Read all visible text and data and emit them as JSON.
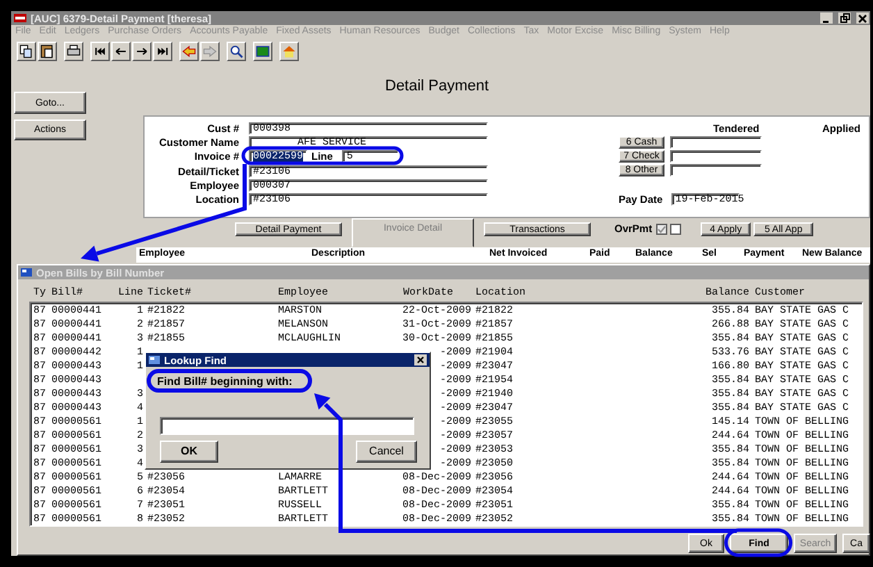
{
  "window": {
    "title": "[AUC] 6379-Detail Payment [theresa]"
  },
  "menu": [
    "File",
    "Edit",
    "Ledgers",
    "Purchase Orders",
    "Accounts Payable",
    "Fixed Assets",
    "Human Resources",
    "Budget",
    "Collections",
    "Tax",
    "Motor Excise",
    "Misc Billing",
    "System",
    "Help"
  ],
  "left_buttons": [
    "Goto...",
    "Actions"
  ],
  "heading": "Detail Payment",
  "form": {
    "fields": [
      {
        "kind": "text",
        "label": "Cust #",
        "value": "000398"
      },
      {
        "kind": "text",
        "label": "Customer Name",
        "value": "AFE SERVICE"
      },
      {
        "kind": "invoice",
        "label": "Invoice #",
        "value": "00022599",
        "selected": true,
        "line_label": "Line",
        "line_value": "5"
      },
      {
        "kind": "text",
        "label": "Detail/Ticket",
        "value": "#23106"
      },
      {
        "kind": "text",
        "label": "Employee",
        "value": "000307"
      },
      {
        "kind": "text",
        "label": "Location",
        "value": "#23106"
      }
    ]
  },
  "payment": {
    "tendered_label": "Tendered",
    "applied_label": "Applied",
    "methods": [
      "6 Cash",
      "7 Check",
      "8 Other"
    ],
    "pay_date_label": "Pay Date",
    "pay_date": "19-Feb-2015"
  },
  "tabs": [
    {
      "label": "Detail Payment",
      "selected": false,
      "disabled": false
    },
    {
      "label": "Invoice Detail",
      "selected": true,
      "disabled": true
    },
    {
      "label": "Transactions",
      "selected": false,
      "disabled": false
    }
  ],
  "overpayment": {
    "label": "OvrPmt",
    "checks": [
      {
        "checked": true,
        "disabled": true
      },
      {
        "checked": false,
        "disabled": false
      }
    ]
  },
  "apply_buttons": [
    "4 Apply",
    "5 All App"
  ],
  "detail_columns": [
    "Employee",
    "Description",
    "Net Invoiced",
    "Paid",
    "Balance",
    "Sel",
    "Payment",
    "New Balance"
  ],
  "bills_window": {
    "title": "Open Bills by Bill Number",
    "columns": [
      "Ty",
      "Bill#",
      "Line",
      "Ticket#",
      "Employee",
      "WorkDate",
      "Location",
      "Balance",
      "Customer"
    ],
    "rows": [
      {
        "ty": "87",
        "bill": "00000441",
        "line": "1",
        "ticket": "#21822",
        "employee": "MARSTON",
        "workdate": "22-Oct-2009",
        "location": "#21822",
        "balance": "355.84",
        "customer": "BAY STATE GAS C"
      },
      {
        "ty": "87",
        "bill": "00000441",
        "line": "2",
        "ticket": "#21857",
        "employee": "MELANSON",
        "workdate": "31-Oct-2009",
        "location": "#21857",
        "balance": "266.88",
        "customer": "BAY STATE GAS C"
      },
      {
        "ty": "87",
        "bill": "00000441",
        "line": "3",
        "ticket": "#21855",
        "employee": "MCLAUGHLIN",
        "workdate": "30-Oct-2009",
        "location": "#21855",
        "balance": "355.84",
        "customer": "BAY STATE GAS C"
      },
      {
        "ty": "87",
        "bill": "00000442",
        "line": "1",
        "workdate": "-2009",
        "location": "#21904",
        "balance": "533.76",
        "customer": "BAY STATE GAS C"
      },
      {
        "ty": "87",
        "bill": "00000443",
        "line": "1",
        "workdate": "-2009",
        "location": "#23047",
        "balance": "166.80",
        "customer": "BAY STATE GAS C"
      },
      {
        "ty": "87",
        "bill": "00000443",
        "workdate": "-2009",
        "location": "#21954",
        "balance": "355.84",
        "customer": "BAY STATE GAS C"
      },
      {
        "ty": "87",
        "bill": "00000443",
        "line": "3",
        "workdate": "-2009",
        "location": "#21940",
        "balance": "355.84",
        "customer": "BAY STATE GAS C"
      },
      {
        "ty": "87",
        "bill": "00000443",
        "line": "4",
        "workdate": "-2009",
        "location": "#23047",
        "balance": "355.84",
        "customer": "BAY STATE GAS C"
      },
      {
        "ty": "87",
        "bill": "00000561",
        "line": "1",
        "workdate": "-2009",
        "location": "#23055",
        "balance": "145.14",
        "customer": "TOWN OF BELLING"
      },
      {
        "ty": "87",
        "bill": "00000561",
        "line": "2",
        "workdate": "-2009",
        "location": "#23057",
        "balance": "244.64",
        "customer": "TOWN OF BELLING"
      },
      {
        "ty": "87",
        "bill": "00000561",
        "line": "3",
        "workdate": "-2009",
        "location": "#23053",
        "balance": "355.84",
        "customer": "TOWN OF BELLING"
      },
      {
        "ty": "87",
        "bill": "00000561",
        "line": "4",
        "workdate": "-2009",
        "location": "#23050",
        "balance": "355.84",
        "customer": "TOWN OF BELLING"
      },
      {
        "ty": "87",
        "bill": "00000561",
        "line": "5",
        "ticket": "#23056",
        "employee": "LAMARRE",
        "workdate": "08-Dec-2009",
        "location": "#23056",
        "balance": "244.64",
        "customer": "TOWN OF BELLING"
      },
      {
        "ty": "87",
        "bill": "00000561",
        "line": "6",
        "ticket": "#23054",
        "employee": "BARTLETT",
        "workdate": "08-Dec-2009",
        "location": "#23054",
        "balance": "244.64",
        "customer": "TOWN OF BELLING"
      },
      {
        "ty": "87",
        "bill": "00000561",
        "line": "7",
        "ticket": "#23051",
        "employee": "RUSSELL",
        "workdate": "08-Dec-2009",
        "location": "#23051",
        "balance": "355.84",
        "customer": "TOWN OF BELLING"
      },
      {
        "ty": "87",
        "bill": "00000561",
        "line": "8",
        "ticket": "#23052",
        "employee": "BARTLETT",
        "workdate": "08-Dec-2009",
        "location": "#23052",
        "balance": "355.84",
        "customer": "TOWN OF BELLING"
      }
    ],
    "buttons": [
      {
        "label": "Ok",
        "disabled": false
      },
      {
        "label": "Find",
        "disabled": false
      },
      {
        "label": "Search",
        "disabled": true
      },
      {
        "label": "Ca",
        "disabled": false
      }
    ]
  },
  "lookup": {
    "title": "Lookup Find",
    "prompt": "Find Bill# beginning with:",
    "ok": "OK",
    "cancel": "Cancel"
  }
}
